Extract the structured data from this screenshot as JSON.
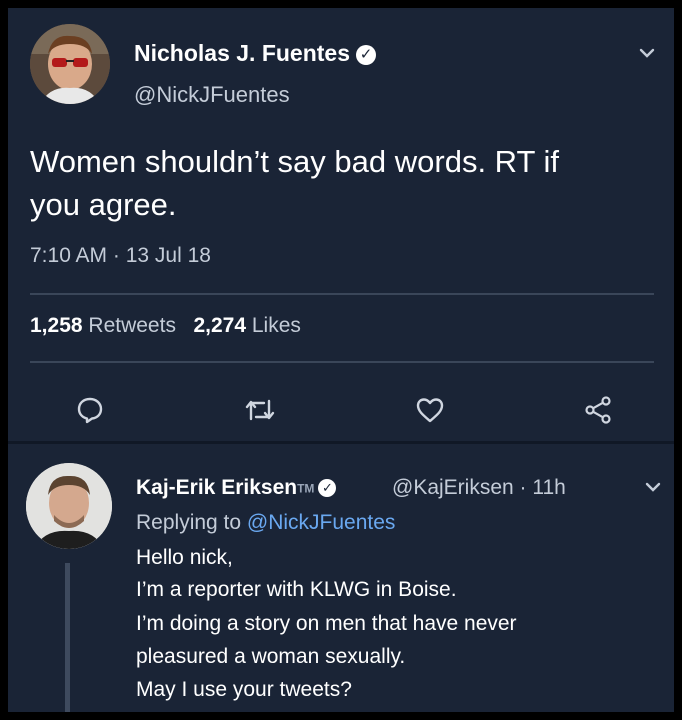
{
  "main_tweet": {
    "author_name": "Nicholas J. Fuentes",
    "author_handle": "@NickJFuentes",
    "text_line_1": "Women shouldn’t say bad words. RT if",
    "text_line_2": "you agree.",
    "timestamp": "7:10 AM · 13 Jul 18",
    "retweets_count": "1,258",
    "retweets_label": "Retweets",
    "likes_count": "2,274",
    "likes_label": "Likes"
  },
  "reply_tweet": {
    "author_name": "Kaj-Erik Eriksen",
    "author_tm": "TM",
    "author_handle": "@KajEriksen",
    "age": "· 11h",
    "replying_prefix": "Replying to",
    "replying_mention": "@NickJFuentes",
    "lines": [
      "Hello nick,",
      "I’m a reporter with KLWG in Boise.",
      "I’m doing a story on men that have never",
      "pleasured a woman sexually.",
      "May I use your tweets?"
    ]
  },
  "icons": {
    "verified": "verified-badge-icon",
    "chevron": "chevron-down-icon",
    "reply": "reply-bubble-icon",
    "retweet": "retweet-icon",
    "like": "heart-icon",
    "share": "share-icon"
  },
  "colors": {
    "background": "#1a2436",
    "text_primary": "#ffffff",
    "text_secondary": "#c4ccd8",
    "link": "#6aa8f0",
    "divider": "#3a4659"
  }
}
